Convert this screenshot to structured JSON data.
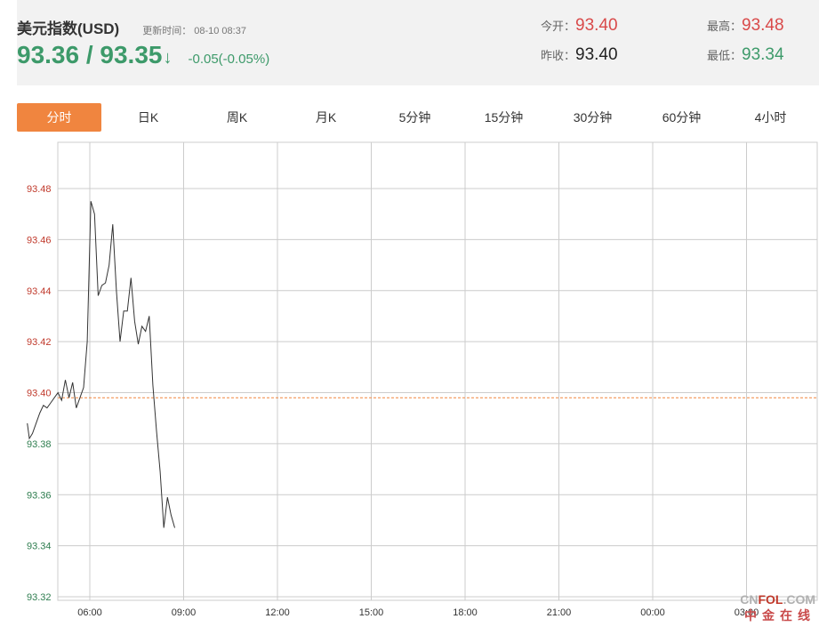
{
  "header": {
    "title": "美元指数(USD)",
    "update_label": "更新时间：",
    "update_time": "08-10 08:37",
    "price": "93.36 / 93.35",
    "arrow": "↓",
    "change": "-0.05(-0.05%)",
    "open_label": "今开：",
    "open_value": "93.40",
    "prev_close_label": "昨收：",
    "prev_close_value": "93.40",
    "high_label": "最高：",
    "high_value": "93.48",
    "low_label": "最低：",
    "low_value": "93.34"
  },
  "tabs": [
    "分时",
    "日K",
    "周K",
    "月K",
    "5分钟",
    "15分钟",
    "30分钟",
    "60分钟",
    "4小时"
  ],
  "active_tab": 0,
  "colors": {
    "accent": "#f0853f",
    "up": "#d94a4a",
    "down": "#3d9a6a",
    "line": "#333333",
    "ref_line": "#f0853f",
    "grid": "#cccccc"
  },
  "chart_data": {
    "type": "line",
    "x_tick_labels": [
      "06:00",
      "09:00",
      "12:00",
      "15:00",
      "18:00",
      "21:00",
      "00:00",
      "03:00"
    ],
    "y_tick_labels": [
      "93.48",
      "93.46",
      "93.44",
      "93.42",
      "93.40",
      "93.38",
      "93.36",
      "93.34",
      "93.32"
    ],
    "ylim": [
      93.32,
      93.48
    ],
    "reference_value": 93.398,
    "grid": true,
    "series": [
      {
        "x": [
          "04:00",
          "04:04",
          "04:10",
          "04:17",
          "04:24",
          "04:31",
          "04:38",
          "04:45",
          "04:52",
          "04:59",
          "05:06",
          "05:13",
          "05:20",
          "05:27",
          "05:34",
          "05:41",
          "05:48",
          "05:55",
          "06:02",
          "06:09",
          "06:16",
          "06:23",
          "06:30",
          "06:37",
          "06:44",
          "06:51",
          "06:58",
          "07:05",
          "07:12",
          "07:19",
          "07:26",
          "07:33",
          "07:40",
          "07:47",
          "07:54",
          "08:01",
          "08:08",
          "08:15",
          "08:22",
          "08:29",
          "08:36",
          "08:43"
        ],
        "values": [
          93.388,
          93.382,
          93.384,
          93.388,
          93.392,
          93.395,
          93.394,
          93.396,
          93.398,
          93.4,
          93.397,
          93.405,
          93.398,
          93.404,
          93.394,
          93.398,
          93.402,
          93.42,
          93.475,
          93.47,
          93.438,
          93.442,
          93.443,
          93.45,
          93.466,
          93.44,
          93.42,
          93.432,
          93.432,
          93.445,
          93.428,
          93.419,
          93.426,
          93.424,
          93.43,
          93.403,
          93.385,
          93.369,
          93.347,
          93.359,
          93.352,
          93.347
        ]
      }
    ]
  },
  "watermark": {
    "top_prefix": "CN",
    "top_brand": "FOL",
    "top_suffix": ".COM",
    "bottom": "中金在线"
  }
}
